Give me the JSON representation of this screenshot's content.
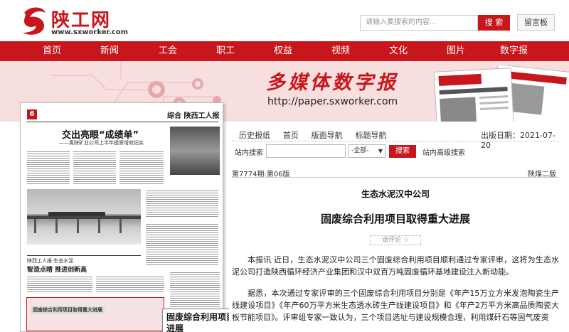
{
  "header": {
    "site_name": "陕工网",
    "site_url": "www.sxworker.com",
    "search_placeholder": "请输入要搜索的内容...",
    "search_button": "搜 索",
    "guestbook_button": "留言板"
  },
  "nav": {
    "items": [
      "首页",
      "新闻",
      "工会",
      "职工",
      "权益",
      "视频",
      "文化",
      "图片",
      "数字报"
    ]
  },
  "banner": {
    "title": "多媒体数字报",
    "url": "http://paper.sxworker.com"
  },
  "newspaper": {
    "page_no": "6",
    "masthead": "综合 陕西工人报",
    "headline": "交出亮眼“成绩单”",
    "subhead": "——奥陕矿业公司上半年提质增效纪实",
    "section_head": "陕西工人报·生态水泥",
    "section_title": "智造点睛  推进创新高",
    "highlight_title": "固废综合利用项目取得重大进展"
  },
  "tooltip": {
    "text": "固废综合利用项目取得重大进展"
  },
  "panel": {
    "links": [
      "历史报纸",
      "首页",
      "版面导航",
      "标题导航"
    ],
    "pub_date": "出版日期：2021-07-20",
    "search_label": "站内搜索",
    "select_value": "-全部-",
    "search_button": "搜索",
    "advanced_search": "站内高级搜索",
    "issue": "第7774期:第06版",
    "edition": "陕煤二版",
    "lead": "生态水泥汉中公司",
    "title": "固废综合利用项目取得重大进展",
    "rate": "请评论 ☆",
    "paragraphs": [
      "本报讯  近日，生态水泥汉中公司三个固废综合利用项目顺利通过专家评审，这将为生态水泥公司打造陕西循环经济产业集团和汉中双百万吨固废循环基地建设注入新动能。",
      "据悉，本次通过专家评审的三个固废综合利用项目分别是《年产15万立方米发泡陶瓷生产线建设项目》《年产60万平方米生态透水砖生产线建设项目》和《年产2万平方米高品质陶瓷大板节能项目》。评审组专家一致认为，三个项目选址与建设规模合理，利用煤矸石等固气废资"
    ]
  },
  "colors": {
    "brand_red": "#c8161d",
    "banner_pink": "#f7dfdf"
  }
}
